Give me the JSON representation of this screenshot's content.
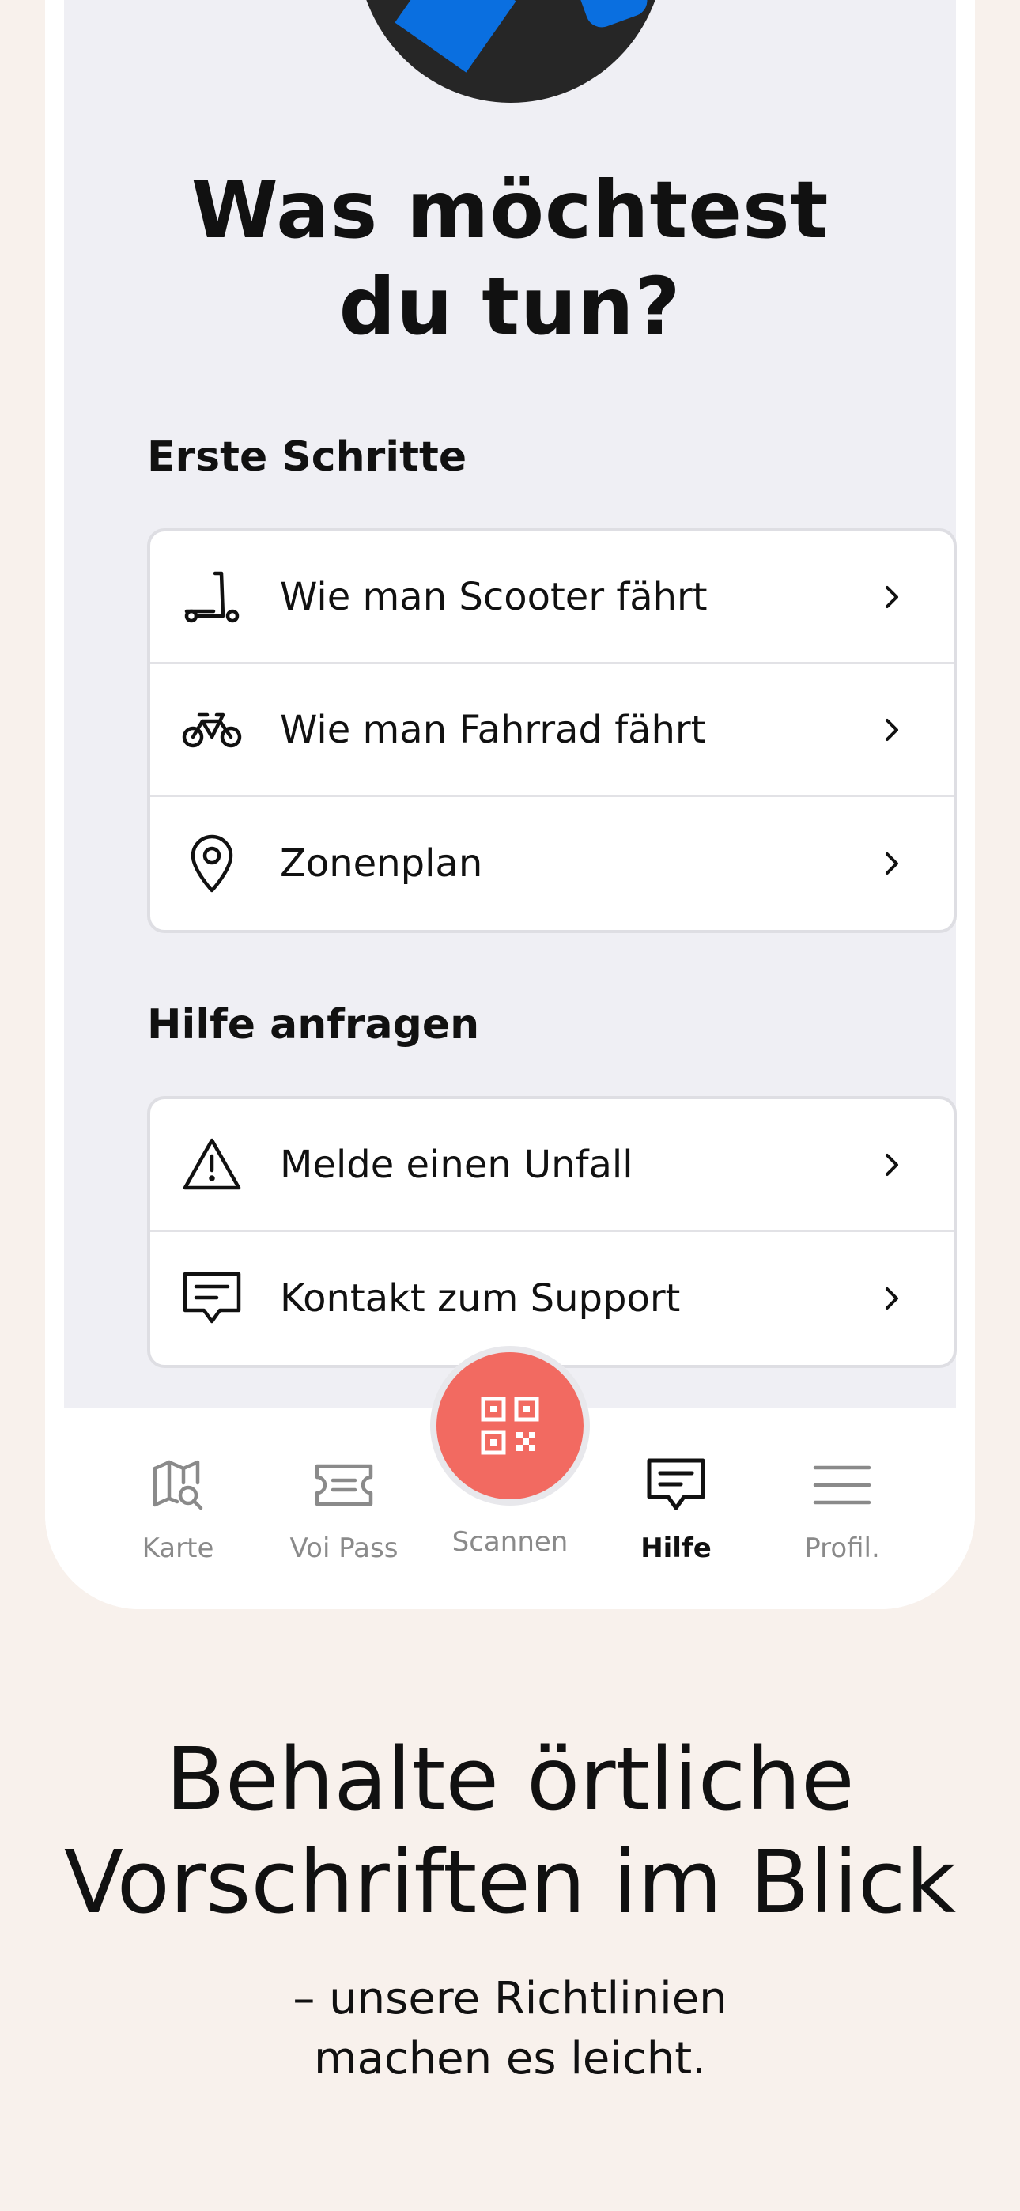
{
  "screen": {
    "headline_line1": "Was möchtest",
    "headline_line2": "du tun?"
  },
  "sections": [
    {
      "title": "Erste Schritte",
      "items": [
        {
          "label": "Wie man Scooter fährt",
          "icon": "scooter-icon"
        },
        {
          "label": "Wie man Fahrrad fährt",
          "icon": "bicycle-icon"
        },
        {
          "label": "Zonenplan",
          "icon": "map-pin-icon"
        }
      ]
    },
    {
      "title": "Hilfe anfragen",
      "items": [
        {
          "label": "Melde einen Unfall",
          "icon": "warning-icon"
        },
        {
          "label": "Kontakt zum Support",
          "icon": "chat-icon"
        }
      ]
    }
  ],
  "tabbar": {
    "tabs": [
      {
        "label": "Karte",
        "icon": "map-search-icon",
        "active": false
      },
      {
        "label": "Voi Pass",
        "icon": "ticket-icon",
        "active": false
      },
      {
        "label": "Scannen",
        "icon": "qr-code-icon",
        "active": false
      },
      {
        "label": "Hilfe",
        "icon": "chat-icon",
        "active": true
      },
      {
        "label": "Profil.",
        "icon": "menu-icon",
        "active": false
      }
    ]
  },
  "promo": {
    "title_line1": "Behalte örtliche",
    "title_line2": "Vorschriften im Blick",
    "subtitle_line1": "– unsere Richtlinien",
    "subtitle_line2": "machen es leicht."
  },
  "colors": {
    "background": "#f8f1ec",
    "screen": "#efeff4",
    "scan_button": "#f26a61",
    "avatar_accent": "#0a6fe0"
  }
}
